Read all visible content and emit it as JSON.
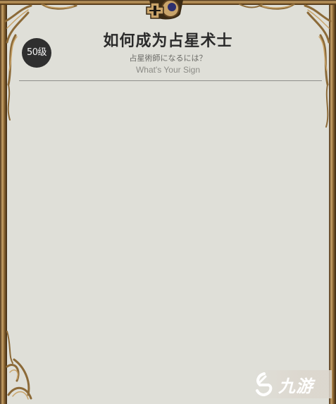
{
  "header": {
    "title": "如何成为占星术士",
    "subtitle_jp": "占星術師になるには？",
    "subtitle_en": "What's Your Sign"
  },
  "level_badge": {
    "label": "50级"
  },
  "watermark": {
    "text": "九游"
  },
  "colors": {
    "parchment": "#dfdfd8",
    "frame_gold": "#b08a4e",
    "frame_dark": "#5a3f1f",
    "crest_blue": "#2d2f6e",
    "title": "#2b2b2b",
    "badge_bg": "#2f2f2f"
  }
}
